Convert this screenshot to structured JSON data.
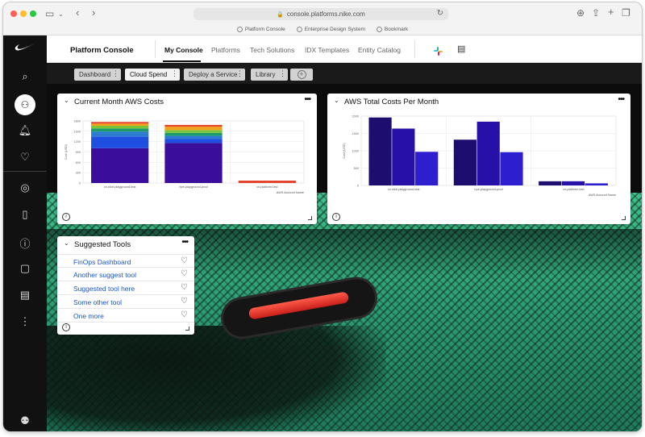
{
  "browser": {
    "url": "console.platforms.nike.com",
    "bookmarks": [
      "Platform Console",
      "Enterprise Design System",
      "Bookmark"
    ]
  },
  "sidebar": {
    "icons": [
      "nike-logo-icon",
      "search-icon",
      "user-check-icon",
      "bell-icon",
      "heart-icon",
      "compass-icon",
      "book-icon",
      "help-icon",
      "chat-icon",
      "notes-icon",
      "more-icon",
      "user-settings-icon"
    ]
  },
  "nav": {
    "brand": "Platform Console",
    "links": [
      "My Console",
      "Platforms",
      "Tech Solutions",
      "IDX Templates",
      "Entity Catalog"
    ],
    "active": "My Console"
  },
  "console_tabs": {
    "tabs": [
      "Dashboard",
      "Cloud Spend",
      "Deploy a Service",
      "Library"
    ],
    "active": "Cloud Spend"
  },
  "cards": {
    "current_month": {
      "title": "Current Month AWS Costs"
    },
    "total_costs": {
      "title": "AWS Total Costs Per Month"
    },
    "suggested_tools": {
      "title": "Suggested Tools",
      "items": [
        "FinOps Dashboard",
        "Another suggest tool",
        "Suggested tool here",
        "Some other tool",
        "One more"
      ]
    }
  },
  "chart_data": [
    {
      "type": "bar",
      "stacked": true,
      "title": "Current Month AWS Costs",
      "xlabel": "AWS Account Name",
      "ylabel": "Cost (USD)",
      "categories": [
        "cn-nike-playground-test",
        "hpe-playground-prod",
        "cn-platform-test"
      ],
      "yticks": [
        0,
        300,
        600,
        900,
        1200,
        1500,
        1800
      ],
      "ylim": [
        0,
        1800
      ],
      "series": [
        {
          "values": [
            1010,
            1160,
            0
          ],
          "color": "#3a0d9a"
        },
        {
          "values": [
            340,
            115,
            0
          ],
          "color": "#1f4fe0"
        },
        {
          "values": [
            140,
            95,
            0
          ],
          "color": "#2a7bd1"
        },
        {
          "values": [
            90,
            85,
            0
          ],
          "color": "#1d9a6a"
        },
        {
          "values": [
            80,
            80,
            0
          ],
          "color": "#7ac43a"
        },
        {
          "values": [
            60,
            100,
            0
          ],
          "color": "#f2a21e"
        },
        {
          "values": [
            50,
            50,
            70
          ],
          "color": "#e5442c"
        }
      ]
    },
    {
      "type": "bar",
      "title": "AWS Total Costs Per Month",
      "xlabel": "AWS Account Name",
      "ylabel": "Cost (USD)",
      "categories": [
        "cn-nike-playground-test",
        "hpe-playground-prod",
        "cn-platform-test"
      ],
      "yticks": [
        0,
        500,
        1000,
        1500,
        2000
      ],
      "ylim": [
        0,
        2000
      ],
      "series": [
        {
          "values": [
            1960,
            1320,
            120
          ],
          "color": "#1c0d6e"
        },
        {
          "values": [
            1640,
            1840,
            120
          ],
          "color": "#2610a8"
        },
        {
          "values": [
            970,
            960,
            60
          ],
          "color": "#2d1fd0"
        }
      ]
    }
  ],
  "colors": {
    "sidebar_bg": "#111111",
    "link": "#1a56c9",
    "accent_green": "#2da076"
  }
}
